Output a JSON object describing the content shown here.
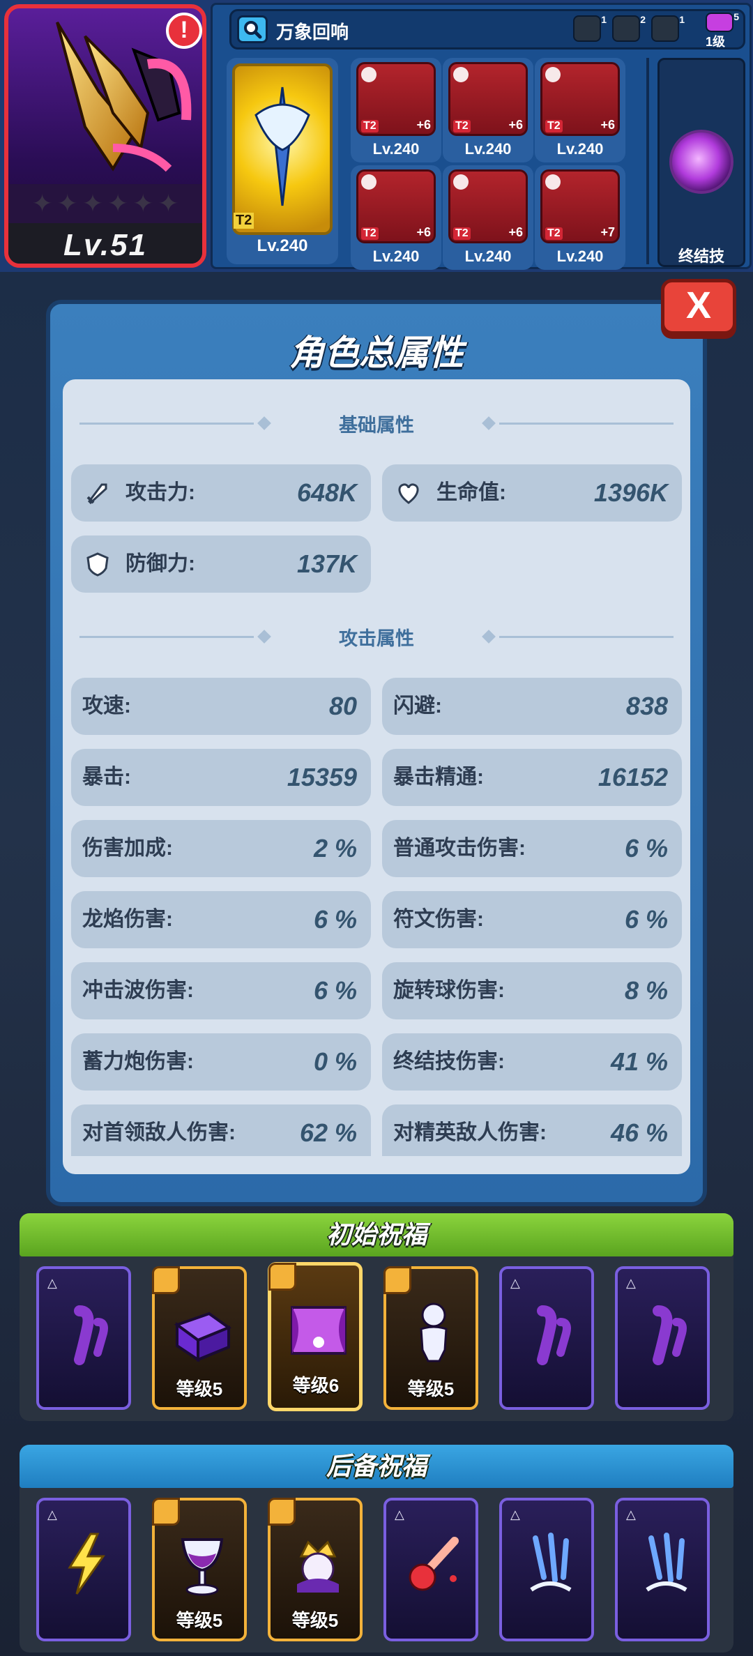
{
  "hero": {
    "level": "Lv.51",
    "alert": "!",
    "stars": [
      "✦",
      "✦",
      "✦",
      "✦",
      "✦",
      "✦"
    ]
  },
  "equipment": {
    "search_text": "万象回响",
    "resources": [
      {
        "name": "wrench-icon",
        "count": "1"
      },
      {
        "name": "snowflake-icon",
        "count": "2"
      },
      {
        "name": "flame-icon",
        "count": "1"
      },
      {
        "name": "skull-icon",
        "count": "5"
      }
    ],
    "resource_level": "1级",
    "weapon": {
      "tier": "T2",
      "level": "Lv.240"
    },
    "gear": [
      {
        "tier": "T2",
        "plus": "+6",
        "level": "Lv.240",
        "slot": "shield"
      },
      {
        "tier": "T2",
        "plus": "+6",
        "level": "Lv.240",
        "slot": "helmet"
      },
      {
        "tier": "T2",
        "plus": "+6",
        "level": "Lv.240",
        "slot": "hourglass"
      },
      {
        "tier": "T2",
        "plus": "+6",
        "level": "Lv.240",
        "slot": "shield"
      },
      {
        "tier": "T2",
        "plus": "+6",
        "level": "Lv.240",
        "slot": "helmet"
      },
      {
        "tier": "T2",
        "plus": "+7",
        "level": "Lv.240",
        "slot": "hourglass"
      }
    ],
    "ultimate_label": "终结技"
  },
  "modal": {
    "title": "角色总属性",
    "close": "X",
    "basic_header": "基础属性",
    "attack_header": "攻击属性",
    "basic_stats": [
      {
        "label": "攻击力:",
        "value": "648K",
        "icon": "sword-icon"
      },
      {
        "label": "生命值:",
        "value": "1396K",
        "icon": "heart-icon"
      },
      {
        "label": "防御力:",
        "value": "137K",
        "icon": "shield-icon"
      }
    ],
    "attack_stats": [
      {
        "label": "攻速:",
        "value": "80"
      },
      {
        "label": "闪避:",
        "value": "838"
      },
      {
        "label": "暴击:",
        "value": "15359"
      },
      {
        "label": "暴击精通:",
        "value": "16152"
      },
      {
        "label": "伤害加成:",
        "value": "2 %"
      },
      {
        "label": "普通攻击伤害:",
        "value": "6 %"
      },
      {
        "label": "龙焰伤害:",
        "value": "6 %"
      },
      {
        "label": "符文伤害:",
        "value": "6 %"
      },
      {
        "label": "冲击波伤害:",
        "value": "6 %"
      },
      {
        "label": "旋转球伤害:",
        "value": "8 %"
      },
      {
        "label": "蓄力炮伤害:",
        "value": "0 %"
      },
      {
        "label": "终结技伤害:",
        "value": "41 %"
      },
      {
        "label": "对首领敌人伤害:",
        "value": "62 %"
      },
      {
        "label": "对精英敌人伤害:",
        "value": "46 %"
      }
    ]
  },
  "initial_blessings": {
    "title": "初始祝福",
    "cards": [
      {
        "state": "locked",
        "icon": "ghost-icon",
        "level": ""
      },
      {
        "state": "owned",
        "icon": "chest-icon",
        "level": "等级5"
      },
      {
        "state": "featured",
        "icon": "stage-icon",
        "level": "等级6"
      },
      {
        "state": "owned",
        "icon": "figure-icon",
        "level": "等级5"
      },
      {
        "state": "locked",
        "icon": "ghost-icon",
        "level": ""
      },
      {
        "state": "locked",
        "icon": "ghost-icon",
        "level": ""
      }
    ]
  },
  "reserve_blessings": {
    "title": "后备祝福",
    "cards": [
      {
        "state": "locked",
        "icon": "lightning-icon",
        "level": ""
      },
      {
        "state": "owned",
        "icon": "goblet-icon",
        "level": "等级5"
      },
      {
        "state": "owned",
        "icon": "crown-icon",
        "level": "等级5"
      },
      {
        "state": "locked",
        "icon": "meteor-icon",
        "level": ""
      },
      {
        "state": "locked",
        "icon": "claw-icon",
        "level": ""
      },
      {
        "state": "locked",
        "icon": "claw-icon",
        "level": ""
      }
    ]
  },
  "colors": {
    "accent_red": "#e8313b",
    "panel_blue": "#1a4f8f",
    "blessing_green": "#8bd43d",
    "blessing_blue": "#3aa6e3"
  }
}
